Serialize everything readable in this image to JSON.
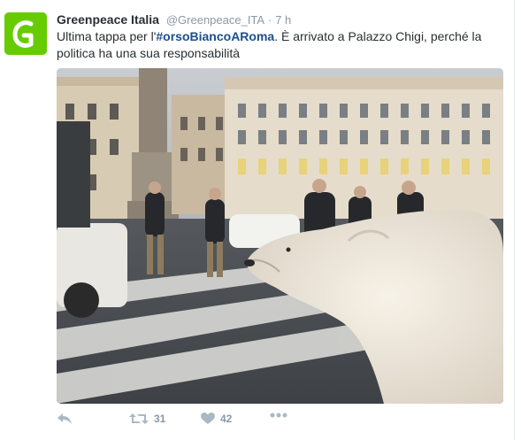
{
  "tweet": {
    "display_name": "Greenpeace Italia",
    "handle": "@Greenpeace_ITA",
    "separator": "·",
    "time": "7 h",
    "text_before": "Ultima tappa per l'",
    "hashtag": "#orsoBiancoARoma",
    "text_after": ". È arrivato a Palazzo Chigi, perché la politica ha una sua responsabilità"
  },
  "actions": {
    "retweet_count": "31",
    "like_count": "42"
  },
  "icons": {
    "avatar": "greenpeace-logo",
    "reply": "reply-icon",
    "retweet": "retweet-icon",
    "like": "heart-icon",
    "more": "more-dots-icon"
  },
  "colors": {
    "brand_green": "#66cc00",
    "hashtag": "#1b4f8f",
    "muted": "#8899a6"
  }
}
